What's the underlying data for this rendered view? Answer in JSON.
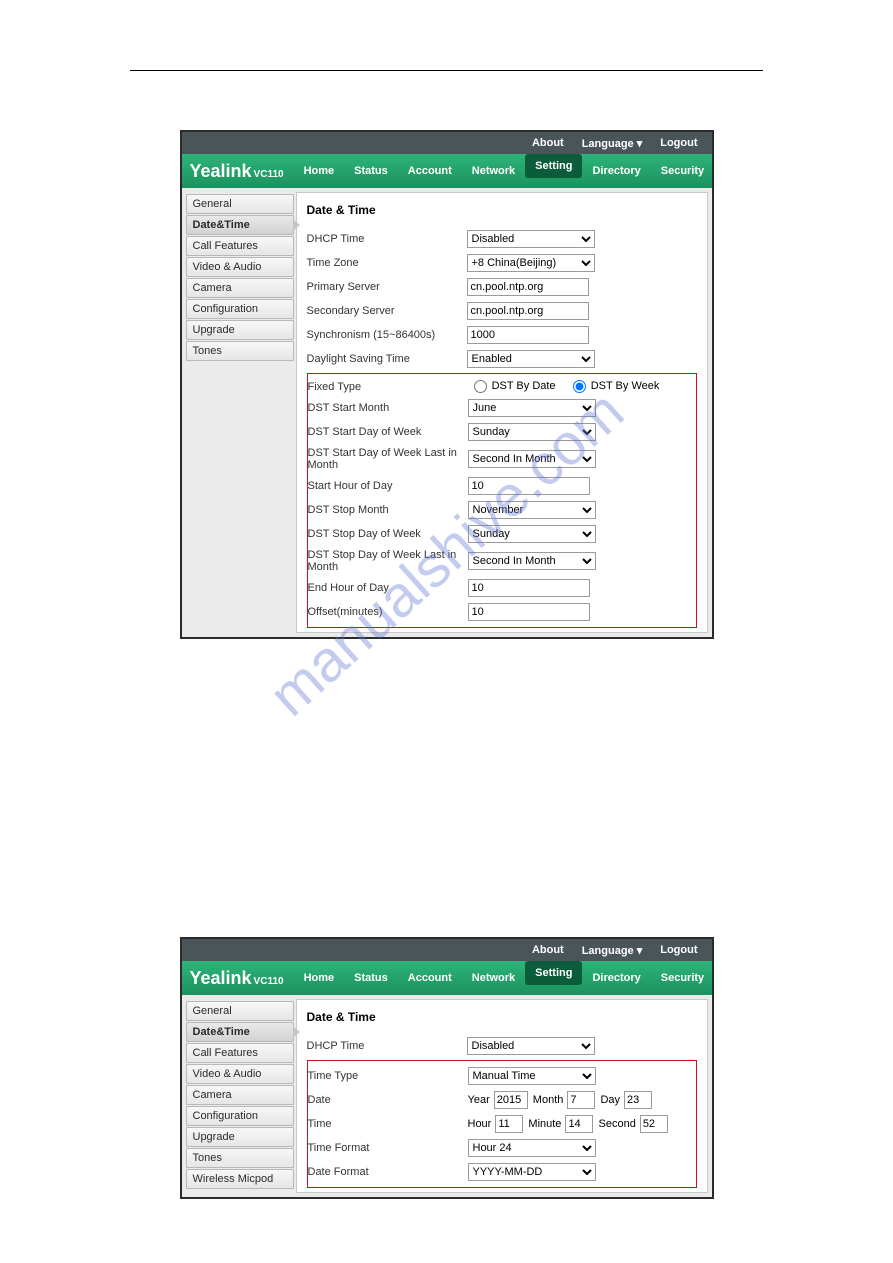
{
  "watermark": "manualshive.com",
  "topbar": {
    "about": "About",
    "language": "Language ▾",
    "logout": "Logout"
  },
  "brand": {
    "name": "Yealink",
    "model": "VC110"
  },
  "nav": [
    "Home",
    "Status",
    "Account",
    "Network",
    "Setting",
    "Directory",
    "Security"
  ],
  "nav_active": "Setting",
  "sidebar1": [
    "General",
    "Date&Time",
    "Call Features",
    "Video & Audio",
    "Camera",
    "Configuration",
    "Upgrade",
    "Tones"
  ],
  "sidebar1_active": "Date&Time",
  "sidebar2": [
    "General",
    "Date&Time",
    "Call Features",
    "Video & Audio",
    "Camera",
    "Configuration",
    "Upgrade",
    "Tones",
    "Wireless Micpod"
  ],
  "sidebar2_active": "Date&Time",
  "section_title": "Date & Time",
  "s1": {
    "dhcp_time_label": "DHCP Time",
    "dhcp_time": "Disabled",
    "timezone_label": "Time Zone",
    "timezone": "+8 China(Beijing)",
    "primary_label": "Primary Server",
    "primary": "cn.pool.ntp.org",
    "secondary_label": "Secondary Server",
    "secondary": "cn.pool.ntp.org",
    "sync_label": "Synchronism (15~86400s)",
    "sync": "1000",
    "dst_label": "Daylight Saving Time",
    "dst": "Enabled",
    "fixed_label": "Fixed Type",
    "opt_date": "DST By Date",
    "opt_week": "DST By Week",
    "start_month_label": "DST Start Month",
    "start_month": "June",
    "start_dow_label": "DST Start Day of Week",
    "start_dow": "Sunday",
    "start_dowlm_label": "DST Start Day of Week Last in Month",
    "start_dowlm": "Second In Month",
    "start_hour_label": "Start Hour of Day",
    "start_hour": "10",
    "stop_month_label": "DST Stop Month",
    "stop_month": "November",
    "stop_dow_label": "DST Stop Day of Week",
    "stop_dow": "Sunday",
    "stop_dowlm_label": "DST Stop Day of Week Last in Month",
    "stop_dowlm": "Second In Month",
    "end_hour_label": "End Hour of Day",
    "end_hour": "10",
    "offset_label": "Offset(minutes)",
    "offset": "10"
  },
  "s2": {
    "dhcp_time_label": "DHCP Time",
    "dhcp_time": "Disabled",
    "time_type_label": "Time Type",
    "time_type": "Manual Time",
    "date_label": "Date",
    "year_l": "Year",
    "year": "2015",
    "month_l": "Month",
    "month": "7",
    "day_l": "Day",
    "day": "23",
    "time_label": "Time",
    "hour_l": "Hour",
    "hour": "11",
    "min_l": "Minute",
    "min": "14",
    "sec_l": "Second",
    "sec": "52",
    "time_fmt_label": "Time Format",
    "time_fmt": "Hour 24",
    "date_fmt_label": "Date Format",
    "date_fmt": "YYYY-MM-DD"
  }
}
